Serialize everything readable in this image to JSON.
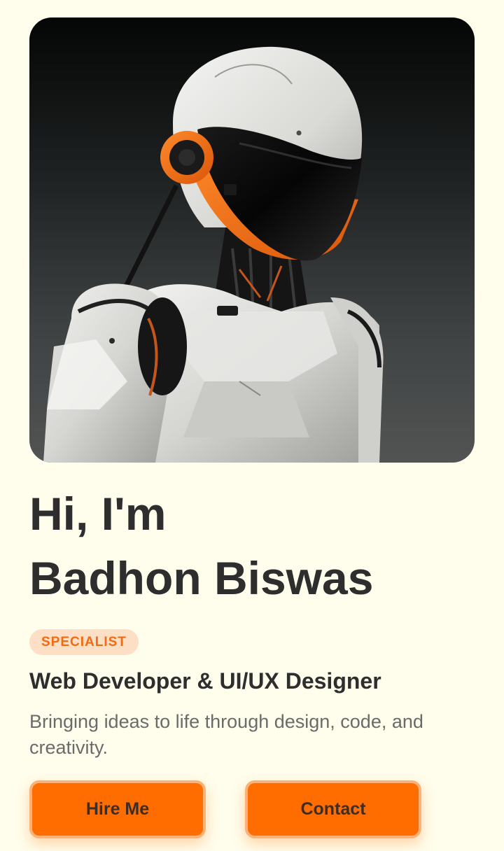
{
  "hero": {
    "image_alt": "White and orange humanoid robot portrait",
    "background_color": "#2a2d2d",
    "accent_color": "#f26b10"
  },
  "intro": {
    "greeting": "Hi, I'm",
    "name": "Badhon Biswas"
  },
  "badge": {
    "label": "SPECIALIST"
  },
  "role": {
    "title": "Web Developer & UI/UX Designer"
  },
  "tagline": {
    "text": "Bringing ideas to life through design, code, and creativity."
  },
  "actions": {
    "hire_label": "Hire Me",
    "contact_label": "Contact"
  },
  "colors": {
    "page_background": "#fffdec",
    "button_orange": "#ff6d00",
    "badge_background": "#fddfc5",
    "heading_text": "#2e2e2e"
  }
}
